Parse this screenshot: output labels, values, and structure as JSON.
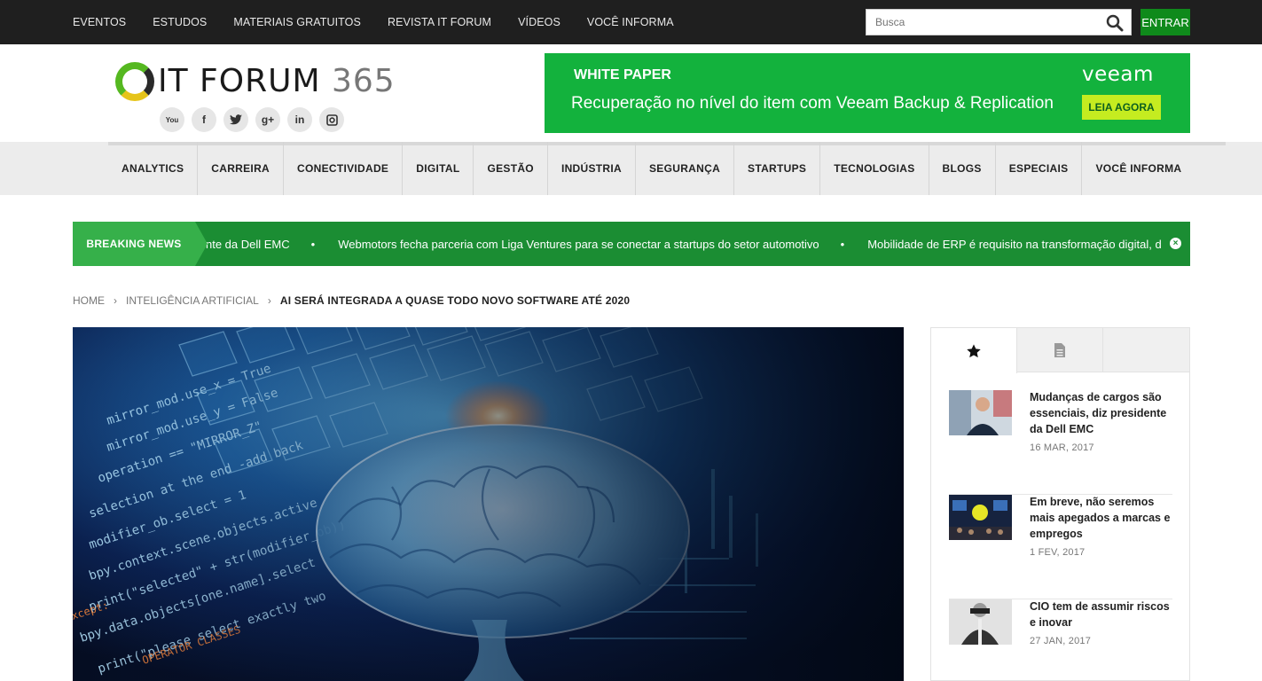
{
  "topnav": {
    "items": [
      "EVENTOS",
      "ESTUDOS",
      "MATERIAIS GRATUITOS",
      "REVISTA IT FORUM",
      "VÍDEOS",
      "VOCÊ INFORMA"
    ],
    "search_placeholder": "Busca",
    "login_label": "ENTRAR"
  },
  "logo": {
    "name": "IT FORUM",
    "number": "365"
  },
  "socials": [
    "youtube-icon",
    "facebook-icon",
    "twitter-icon",
    "google-plus-icon",
    "linkedin-icon",
    "instagram-icon"
  ],
  "ad": {
    "eyebrow": "WHITE PAPER",
    "title": "Recuperação no nível do item com Veeam Backup & Replication",
    "brand": "veeam",
    "cta": "LEIA AGORA",
    "color": "#13b23d"
  },
  "categories": [
    "ANALYTICS",
    "CARREIRA",
    "CONECTIVIDADE",
    "DIGITAL",
    "GESTÃO",
    "INDÚSTRIA",
    "SEGURANÇA",
    "STARTUPS",
    "TECNOLOGIAS",
    "BLOGS",
    "ESPECIAIS",
    "VOCÊ INFORMA"
  ],
  "breaking": {
    "label": "BREAKING NEWS",
    "items": [
      "nte da Dell EMC",
      "Webmotors fecha parceria com Liga Ventures para se conectar a startups do setor automotivo",
      "Mobilidade de ERP é requisito na transformação digital, diz est"
    ],
    "separator": "•"
  },
  "breadcrumb": {
    "home": "HOME",
    "section": "INTELIGÊNCIA ARTIFICIAL",
    "current": "AI SERÁ INTEGRADA A QUASE TODO NOVO SOFTWARE ATÉ 2020"
  },
  "sidebar": {
    "tabs": [
      "star-icon",
      "document-icon"
    ],
    "posts": [
      {
        "title": "Mudanças de cargos são essenciais, diz presidente da Dell EMC",
        "date": "16 MAR, 2017"
      },
      {
        "title": "Em breve, não seremos mais apegados a marcas e empregos",
        "date": "1 FEV, 2017"
      },
      {
        "title": "CIO tem de assumir riscos e inovar",
        "date": "27 JAN, 2017"
      }
    ]
  },
  "colors": {
    "brand_green": "#1b8d33",
    "accent": "#36b04a",
    "topbar": "#1f1f1f"
  }
}
